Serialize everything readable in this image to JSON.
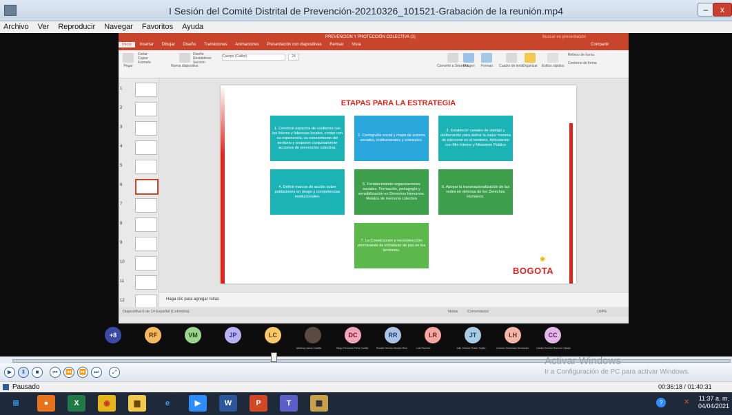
{
  "window": {
    "title": "I Sesión del Comité Distrital de Prevención-20210326_101521-Grabación de la reunión.mp4",
    "min": "–",
    "max": "□",
    "close": "x"
  },
  "menu": [
    "Archivo",
    "Ver",
    "Reproducir",
    "Navegar",
    "Favoritos",
    "Ayuda"
  ],
  "ppt": {
    "doc_title": "PREVENCIÓN Y PROTECCIÓN COLECTIVA (1)",
    "search_placeholder": "Buscar en presentación",
    "tabs": [
      "Inicio",
      "Insertar",
      "Dibujar",
      "Diseño",
      "Transiciones",
      "Animaciones",
      "Presentación con diapositivas",
      "Revisar",
      "Vista"
    ],
    "share": "Compartir",
    "ribbon": {
      "paste": "Pegar",
      "cut": "Cortar",
      "copy": "Copiar",
      "format": "Formato",
      "new_slide": "Nueva diapositiva",
      "design": "Diseño",
      "reset": "Restablecer",
      "section": "Sección",
      "font": "Cuerpo (Calibri)",
      "font_size": "24",
      "convert": "Convertir a SmartArt",
      "image": "Imagen",
      "shapes": "Formas",
      "textbox": "Cuadro de texto",
      "arrange": "Organizar",
      "styles": "Estilos rápidos",
      "fill": "Relleno de forma",
      "outline": "Contorno de forma"
    },
    "slides": [
      "1",
      "2",
      "3",
      "4",
      "5",
      "6",
      "7",
      "8",
      "9",
      "10",
      "11",
      "12"
    ],
    "selected_slide": 6,
    "slide": {
      "title": "ETAPAS PARA LA ESTRATEGIA",
      "boxes": [
        "1. Construir espacios de confianza con los líderes y lideresas locales, contar con su experiencia, su conocimiento del territorio y proponer conjuntamente acciones de prevención colectiva.",
        "2. Cartografía social y mapa de actores sociales, institucionales y eclesiales.",
        "3. Establecer canales de diálogo y deliberación para definir la mejor manera de intervenir en el territorio. Articulación con Min Interior y Ministerio Público",
        "4. Definir marcos de acción sobre poblaciones en riesgo y competencias institucionales.",
        "5. Fortalecimiento organizaciones sociales. Formación, pedagogía y sensibilización en Derechos Humanos. Relatos de memoria colectiva",
        "6. Apoyar la transnacionalización de las redes en defensa de los Derechos Humanos.",
        "7. La Construcción y reconstrucción permanente de iniciativas de paz en los territorios."
      ],
      "logo": "BOGOTA"
    },
    "notes": "Haga clic para agregar notas",
    "status_left": "Diapositiva 6 de 14   Español (Colombia)",
    "status_notes": "Notas",
    "status_comments": "Comentarios",
    "zoom": "104%"
  },
  "participants": [
    {
      "initials": "+8",
      "name": "",
      "bg": "#3b4aa5",
      "fg": "#ffffff"
    },
    {
      "initials": "RF",
      "name": "",
      "bg": "#f4b860",
      "fg": "#5a3200"
    },
    {
      "initials": "VM",
      "name": "",
      "bg": "#9bd48c",
      "fg": "#1d4a14"
    },
    {
      "initials": "JP",
      "name": "",
      "bg": "#b8b3f0",
      "fg": "#2d2680"
    },
    {
      "initials": "LC",
      "name": "",
      "bg": "#f6c86a",
      "fg": "#5a3a00"
    },
    {
      "initials": "",
      "name": "Marleny Lamus Castillo",
      "bg": "#5a4a40",
      "fg": "#ffffff"
    },
    {
      "initials": "DC",
      "name": "Diego Fernando Peña Carrillo",
      "bg": "#f0a6b8",
      "fg": "#6a1030"
    },
    {
      "initials": "RR",
      "name": "Rosalie Herrera Montes Rico",
      "bg": "#a9c4e6",
      "fg": "#1a3a63"
    },
    {
      "initials": "LR",
      "name": "Luis Ramírez",
      "bg": "#f4a6a0",
      "fg": "#6a1d16"
    },
    {
      "initials": "JT",
      "name": "Julio Orlando Tirado Trujillo",
      "bg": "#a8cbe6",
      "fg": "#173f63"
    },
    {
      "initials": "LH",
      "name": "Leandro Simancas Hernández",
      "bg": "#f2b7a8",
      "fg": "#6a2616"
    },
    {
      "initials": "CC",
      "name": "Camilo Ernesto Ramírez Clavijo",
      "bg": "#e3b8e8",
      "fg": "#5a1a66"
    }
  ],
  "player": {
    "status": "Pausado",
    "time": "00:36:18 / 01:40:31",
    "watermark_title": "Activar Windows",
    "watermark_sub": "Ir a Configuración de PC para activar Windows."
  },
  "taskbar": {
    "clock_time": "11:37 a. m.",
    "clock_date": "04/04/2021",
    "apps": [
      {
        "name": "start",
        "bg": "#1e2a3a",
        "fg": "#3aa0ff",
        "glyph": "⊞"
      },
      {
        "name": "firefox",
        "bg": "#e8731e",
        "fg": "#ffffff",
        "glyph": "●"
      },
      {
        "name": "excel",
        "bg": "#1f7a45",
        "fg": "#ffffff",
        "glyph": "X"
      },
      {
        "name": "chrome",
        "bg": "#e6b41d",
        "fg": "#c53a2a",
        "glyph": "◉"
      },
      {
        "name": "explorer",
        "bg": "#f2c94c",
        "fg": "#6b4a00",
        "glyph": "▆"
      },
      {
        "name": "edge",
        "bg": "#1e2a3a",
        "fg": "#3aa0ff",
        "glyph": "e"
      },
      {
        "name": "zoom",
        "bg": "#2d8cff",
        "fg": "#ffffff",
        "glyph": "▶"
      },
      {
        "name": "word",
        "bg": "#2b579a",
        "fg": "#ffffff",
        "glyph": "W"
      },
      {
        "name": "powerpoint",
        "bg": "#d24726",
        "fg": "#ffffff",
        "glyph": "P"
      },
      {
        "name": "teams",
        "bg": "#5b5fc7",
        "fg": "#ffffff",
        "glyph": "T"
      },
      {
        "name": "video-app",
        "bg": "#c8a04a",
        "fg": "#1e2a3a",
        "glyph": "▦"
      }
    ]
  }
}
